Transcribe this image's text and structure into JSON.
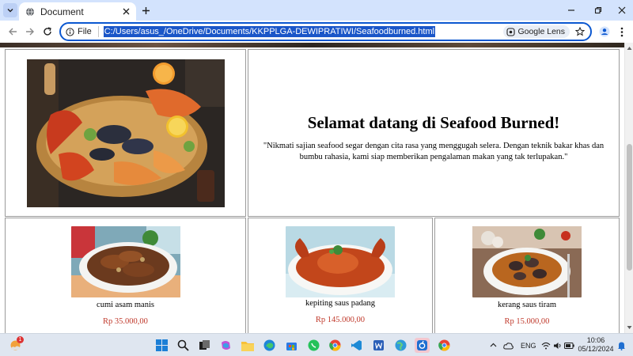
{
  "browser": {
    "tab_title": "Document",
    "site_info_label": "File",
    "url": "C:/Users/asus_/OneDrive/Documents/KKPPLGA-DEWIPRATIWI/Seafoodburned.html",
    "lens_label": "Google Lens"
  },
  "page": {
    "welcome_title": "Selamat datang di Seafood Burned!",
    "welcome_text": "\"Nikmati sajian seafood segar dengan cita rasa yang menggugah selera. Dengan teknik bakar khas dan bumbu rahasia, kami siap memberikan pengalaman makan yang tak terlupakan.\"",
    "menu": [
      {
        "name": "cumi asam manis",
        "price": "Rp 35.000,00"
      },
      {
        "name": "kepiting saus padang",
        "price": "Rp 145.000,00"
      },
      {
        "name": "kerang saus tiram",
        "price": "Rp 15.000,00"
      }
    ]
  },
  "taskbar": {
    "notification_count": "1",
    "language": "ENG",
    "time": "10:06",
    "date": "05/12/2024"
  },
  "colors": {
    "accent": "#0b57d0",
    "tab_strip": "#d3e3fd",
    "price": "#c0392b",
    "url_selection": "#1a56c8"
  }
}
